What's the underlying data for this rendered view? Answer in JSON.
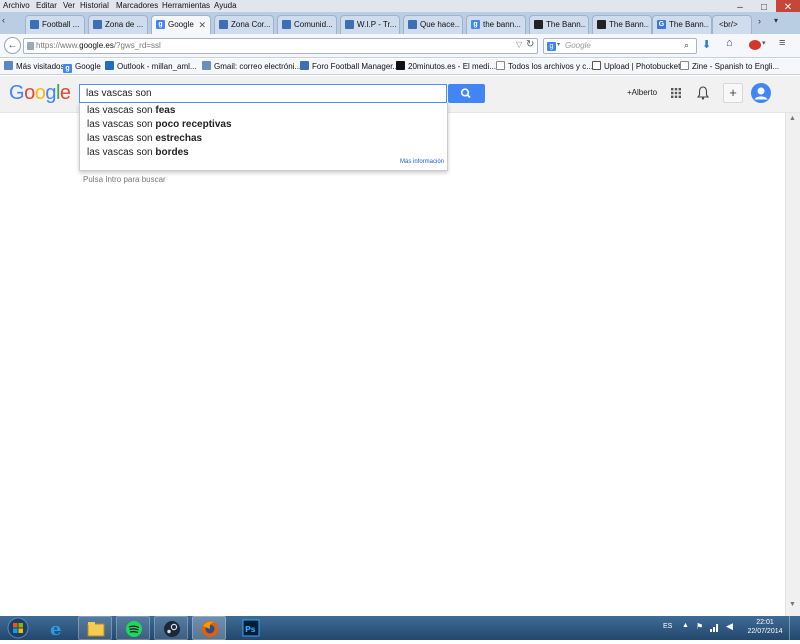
{
  "menu": [
    "Archivo",
    "Editar",
    "Ver",
    "Historial",
    "Marcadores",
    "Herramientas",
    "Ayuda"
  ],
  "window_controls": {
    "minimize": "–",
    "maximize": "□",
    "close": "✕"
  },
  "tabs": [
    {
      "title": "Football ...",
      "active": false
    },
    {
      "title": "Zona de ...",
      "active": false
    },
    {
      "title": "Google",
      "active": true
    },
    {
      "title": "Zona Cor...",
      "active": false
    },
    {
      "title": "Comunid...",
      "active": false
    },
    {
      "title": "W.I.P - Tr...",
      "active": false
    },
    {
      "title": "Que hace...",
      "active": false
    },
    {
      "title": "the bann...",
      "active": false
    },
    {
      "title": "The Bann...",
      "active": false
    },
    {
      "title": "The Bann...",
      "active": false
    },
    {
      "title": "The Bann...",
      "active": false
    },
    {
      "title": "<br/>",
      "active": false
    }
  ],
  "tab_close": "✕",
  "nav": {
    "url_prefix": "https://www.",
    "url_domain": "google.es",
    "url_suffix": "/?gws_rd=ssl",
    "search_placeholder": "Google"
  },
  "bookmarks": [
    "Más visitados",
    "Google",
    "Outlook - millan_aml...",
    "Gmail: correo electróni...",
    "Foro Football Manager...",
    "20minutos.es - El medi...",
    "Todos los archivos y c...",
    "Upload | Photobucket",
    "Zine - Spanish to Engli..."
  ],
  "google": {
    "logo": "Google",
    "query": "las vascas son",
    "user": "+Alberto",
    "suggestions": [
      {
        "prefix": "las vascas son ",
        "completion": "feas"
      },
      {
        "prefix": "las vascas son ",
        "completion": "poco receptivas"
      },
      {
        "prefix": "las vascas son ",
        "completion": "estrechas"
      },
      {
        "prefix": "las vascas son ",
        "completion": "bordes"
      }
    ],
    "more_info": "Más información",
    "hint": "Pulsa Intro para buscar"
  },
  "taskbar": {
    "language": "ES",
    "time": "22:01",
    "date": "22/07/2014"
  },
  "colors": {
    "google_blue": "#4285f4",
    "google_red": "#ea4335",
    "google_yellow": "#fbbc05",
    "google_green": "#34a853",
    "taskbar": "#2b5178"
  }
}
